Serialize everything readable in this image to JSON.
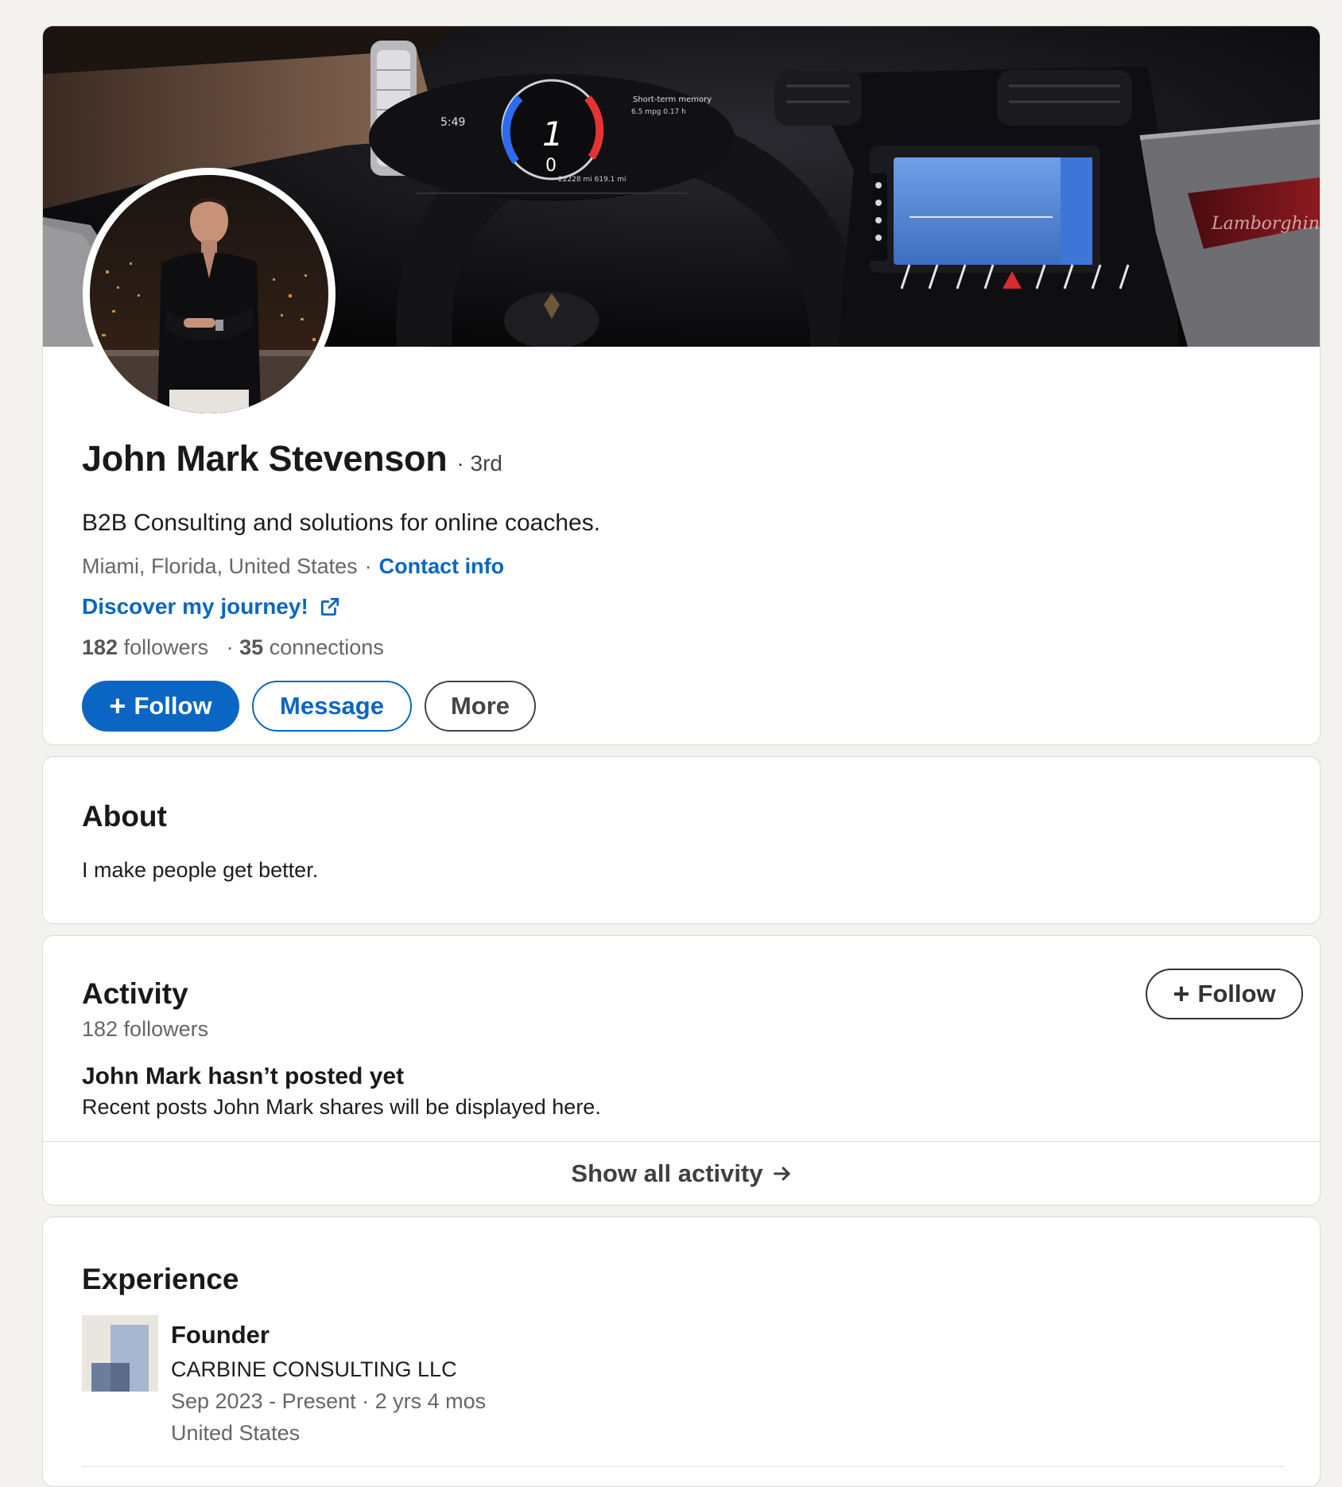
{
  "profile": {
    "name": "John Mark Stevenson",
    "degree": "· 3rd",
    "headline": "B2B Consulting and solutions for online coaches.",
    "location": "Miami, Florida, United States",
    "location_separator": "·",
    "contact_info_label": "Contact info",
    "journey_link_label": "Discover my journey!",
    "followers_count": "182",
    "followers_label": "followers",
    "connections_separator": "·",
    "connections_count": "35",
    "connections_label": "connections",
    "follow_label": "Follow",
    "message_label": "Message",
    "more_label": "More",
    "banner_icon": "car-dashboard-photo",
    "avatar_icon": "profile-photo",
    "external_link_icon": "external-link-icon"
  },
  "about": {
    "title": "About",
    "text": "I make people get better."
  },
  "activity": {
    "title": "Activity",
    "followers": "182 followers",
    "follow_label": "Follow",
    "empty_title": "John Mark hasn’t posted yet",
    "empty_subtitle": "Recent posts John Mark shares will be displayed here.",
    "show_all_label": "Show all activity"
  },
  "experience": {
    "title": "Experience",
    "items": [
      {
        "role": "Founder",
        "company": "CARBINE CONSULTING LLC",
        "dates": "Sep 2023 - Present · 2 yrs 4 mos",
        "location": "United States"
      }
    ]
  },
  "colors": {
    "accent": "#0a66c2",
    "page_background": "#f4f2ee",
    "card_background": "#ffffff"
  }
}
